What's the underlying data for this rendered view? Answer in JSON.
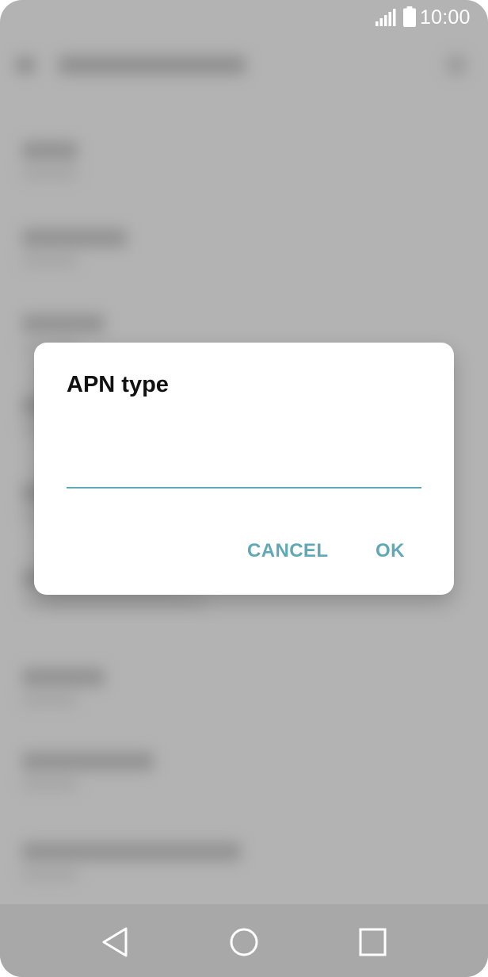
{
  "status_bar": {
    "time": "10:00",
    "icons": [
      "signal-icon",
      "battery-icon"
    ],
    "color": "#ffffff"
  },
  "dialog": {
    "title": "APN type",
    "input": {
      "value": "",
      "placeholder": ""
    },
    "cancel_label": "CANCEL",
    "ok_label": "OK",
    "accent_color": "#5fa8b6"
  },
  "navigation_bar": {
    "buttons": [
      "back-icon",
      "home-icon",
      "recents-icon"
    ]
  },
  "colors": {
    "scrim": "#b3b3b3",
    "dialog_background": "#ffffff",
    "title_text": "#111111"
  }
}
